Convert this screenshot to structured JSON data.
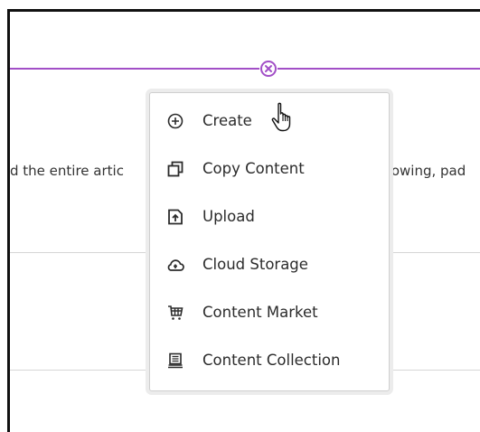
{
  "content": {
    "text_left": "d the entire artic",
    "text_right": "rowing, pad"
  },
  "add_menu": {
    "items": [
      {
        "label": "Create",
        "icon": "plus-circle-icon"
      },
      {
        "label": "Copy Content",
        "icon": "copy-icon"
      },
      {
        "label": "Upload",
        "icon": "upload-icon"
      },
      {
        "label": "Cloud Storage",
        "icon": "cloud-storage-icon"
      },
      {
        "label": "Content Market",
        "icon": "cart-icon"
      },
      {
        "label": "Content Collection",
        "icon": "collection-icon"
      }
    ]
  },
  "colors": {
    "accent": "#a24fc7",
    "text": "#2b2b2b",
    "divider": "#d6d6d6"
  }
}
